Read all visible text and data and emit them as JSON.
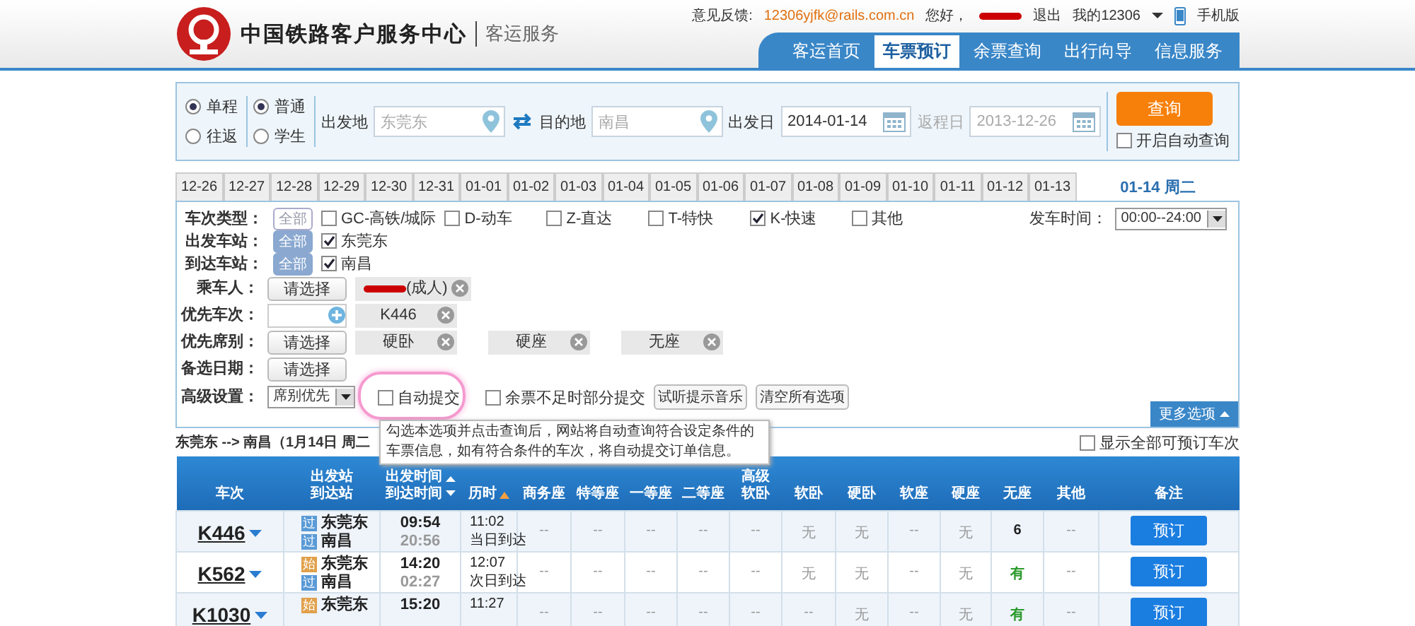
{
  "header": {
    "title": "中国铁路客户服务中心",
    "subtitle": "客运服务",
    "feedback_label": "意见反馈:",
    "feedback_email": "12306yjfk@rails.com.cn",
    "greeting": "您好，",
    "logout": "退出",
    "my_account": "我的12306",
    "mobile": "手机版",
    "nav": [
      {
        "label": "客运首页",
        "selected": false
      },
      {
        "label": "车票预订",
        "selected": true
      },
      {
        "label": "余票查询",
        "selected": false
      },
      {
        "label": "出行向导",
        "selected": false
      },
      {
        "label": "信息服务",
        "selected": false
      }
    ]
  },
  "search": {
    "trip_types": [
      {
        "label": "单程",
        "selected": true
      },
      {
        "label": "往返",
        "selected": false
      }
    ],
    "passenger_types": [
      {
        "label": "普通",
        "selected": true
      },
      {
        "label": "学生",
        "selected": false
      }
    ],
    "from_label": "出发地",
    "from_value": "东莞东",
    "to_label": "目的地",
    "to_value": "南昌",
    "depart_label": "出发日",
    "depart_value": "2014-01-14",
    "return_label": "返程日",
    "return_value": "2013-12-26",
    "query_button": "查询",
    "auto_query": {
      "label": "开启自动查询",
      "checked": false
    }
  },
  "dates": [
    {
      "label": "12-26",
      "selected": false
    },
    {
      "label": "12-27",
      "selected": false
    },
    {
      "label": "12-28",
      "selected": false
    },
    {
      "label": "12-29",
      "selected": false
    },
    {
      "label": "12-30",
      "selected": false
    },
    {
      "label": "12-31",
      "selected": false
    },
    {
      "label": "01-01",
      "selected": false
    },
    {
      "label": "01-02",
      "selected": false
    },
    {
      "label": "01-03",
      "selected": false
    },
    {
      "label": "01-04",
      "selected": false
    },
    {
      "label": "01-05",
      "selected": false
    },
    {
      "label": "01-06",
      "selected": false
    },
    {
      "label": "01-07",
      "selected": false
    },
    {
      "label": "01-08",
      "selected": false
    },
    {
      "label": "01-09",
      "selected": false
    },
    {
      "label": "01-10",
      "selected": false
    },
    {
      "label": "01-11",
      "selected": false
    },
    {
      "label": "01-12",
      "selected": false
    },
    {
      "label": "01-13",
      "selected": false
    },
    {
      "label": "01-14 周二",
      "selected": true
    }
  ],
  "filters": {
    "train_type": {
      "label": "车次类型：",
      "all_label": "全部",
      "all_selected": false,
      "options": [
        {
          "label": "GC-高铁/城际",
          "checked": false
        },
        {
          "label": "D-动车",
          "checked": false
        },
        {
          "label": "Z-直达",
          "checked": false
        },
        {
          "label": "T-特快",
          "checked": false
        },
        {
          "label": "K-快速",
          "checked": true
        },
        {
          "label": "其他",
          "checked": false
        }
      ]
    },
    "depart_time_label": "发车时间：",
    "depart_time_value": "00:00--24:00",
    "from_station": {
      "label": "出发车站：",
      "all_label": "全部",
      "all_selected": true,
      "options": [
        {
          "label": "东莞东",
          "checked": true
        }
      ]
    },
    "to_station": {
      "label": "到达车站：",
      "all_label": "全部",
      "all_selected": true,
      "options": [
        {
          "label": "南昌",
          "checked": true
        }
      ]
    },
    "passenger": {
      "label": "乘车人：",
      "button": "请选择",
      "chips": [
        {
          "label": "(成人)",
          "redacted": true
        }
      ]
    },
    "priority_train": {
      "label": "优先车次：",
      "chips": [
        {
          "label": "K446",
          "redacted": false
        }
      ]
    },
    "priority_seat": {
      "label": "优先席别：",
      "button": "请选择",
      "chips": [
        {
          "label": "硬卧",
          "redacted": false
        },
        {
          "label": "硬座",
          "redacted": false
        },
        {
          "label": "无座",
          "redacted": false
        }
      ]
    },
    "alt_date": {
      "label": "备选日期：",
      "button": "请选择"
    },
    "advanced": {
      "label": "高级设置：",
      "select_value": "席别优先",
      "auto_submit": {
        "label": "自动提交",
        "checked": false
      },
      "partial_submit": {
        "label": "余票不足时部分提交",
        "checked": false
      },
      "music_button": "试听提示音乐",
      "clear_button": "清空所有选项"
    },
    "more_button": "更多选项"
  },
  "tooltip": "勾选本选项并点击查询后，网站将自动查询符合设定条件的车票信息，如有符合条件的车次，将自动提交订单信息。",
  "route_summary": "东莞东 --> 南昌（1月14日  周二",
  "show_all": {
    "label": "显示全部可预订车次",
    "checked": false
  },
  "table": {
    "columns": [
      {
        "lines": [
          "车次"
        ]
      },
      {
        "lines": [
          "出发站",
          "到达站"
        ]
      },
      {
        "lines": [
          "出发时间",
          "到达时间"
        ]
      },
      {
        "lines": [
          "历时"
        ]
      },
      {
        "lines": [
          "商务座"
        ]
      },
      {
        "lines": [
          "特等座"
        ]
      },
      {
        "lines": [
          "一等座"
        ]
      },
      {
        "lines": [
          "二等座"
        ]
      },
      {
        "lines": [
          "高级",
          "软卧"
        ]
      },
      {
        "lines": [
          "软卧"
        ]
      },
      {
        "lines": [
          "硬卧"
        ]
      },
      {
        "lines": [
          "软座"
        ]
      },
      {
        "lines": [
          "硬座"
        ]
      },
      {
        "lines": [
          "无座"
        ]
      },
      {
        "lines": [
          "其他"
        ]
      },
      {
        "lines": [
          "备注"
        ]
      }
    ],
    "rows": [
      {
        "train": "K446",
        "from": {
          "badge": "过",
          "kind": "pass",
          "name": "东莞东"
        },
        "to": {
          "badge": "过",
          "kind": "pass",
          "name": "南昌"
        },
        "depart": "09:54",
        "arrive": "20:56",
        "duration": "11:02",
        "arrival_day": "当日到达",
        "seats": [
          "--",
          "--",
          "--",
          "--",
          "--",
          "无",
          "无",
          "--",
          "无",
          "6",
          "--"
        ],
        "button": "预订"
      },
      {
        "train": "K562",
        "from": {
          "badge": "始",
          "kind": "start",
          "name": "东莞东"
        },
        "to": {
          "badge": "过",
          "kind": "pass",
          "name": "南昌"
        },
        "depart": "14:20",
        "arrive": "02:27",
        "duration": "12:07",
        "arrival_day": "次日到达",
        "seats": [
          "--",
          "--",
          "--",
          "--",
          "--",
          "无",
          "无",
          "--",
          "无",
          "有",
          "--"
        ],
        "button": "预订"
      },
      {
        "train": "K1030",
        "from": {
          "badge": "始",
          "kind": "start",
          "name": "东莞东"
        },
        "depart": "15:20",
        "duration": "11:27",
        "seats": [
          "--",
          "--",
          "--",
          "--",
          "--",
          "--",
          "无",
          "--",
          "无",
          "有",
          "--"
        ],
        "button": "预订"
      }
    ]
  }
}
